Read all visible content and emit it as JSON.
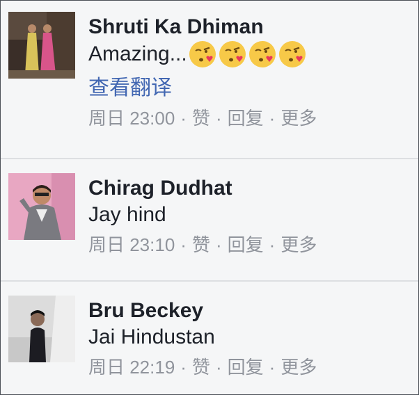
{
  "comments": [
    {
      "author": "Shruti Ka Dhiman",
      "text": "Amazing...",
      "emoji": [
        "face-blowing-kiss-icon",
        "face-blowing-kiss-icon",
        "face-blowing-kiss-icon",
        "face-blowing-kiss-icon"
      ],
      "translate_label": "查看翻译",
      "time": "周日 23:00",
      "like_label": "赞",
      "reply_label": "回复",
      "more_label": "更多"
    },
    {
      "author": "Chirag Dudhat",
      "text": "Jay hind",
      "time": "周日 23:10",
      "like_label": "赞",
      "reply_label": "回复",
      "more_label": "更多"
    },
    {
      "author": "Bru Beckey",
      "text": "Jai Hindustan",
      "time": "周日 22:19",
      "like_label": "赞",
      "reply_label": "回复",
      "more_label": "更多"
    }
  ],
  "separator": "·",
  "colors": {
    "background": "#f5f6f7",
    "name": "#1d2129",
    "link": "#4267b2",
    "meta": "#90949c",
    "divider": "#dddfe2"
  }
}
